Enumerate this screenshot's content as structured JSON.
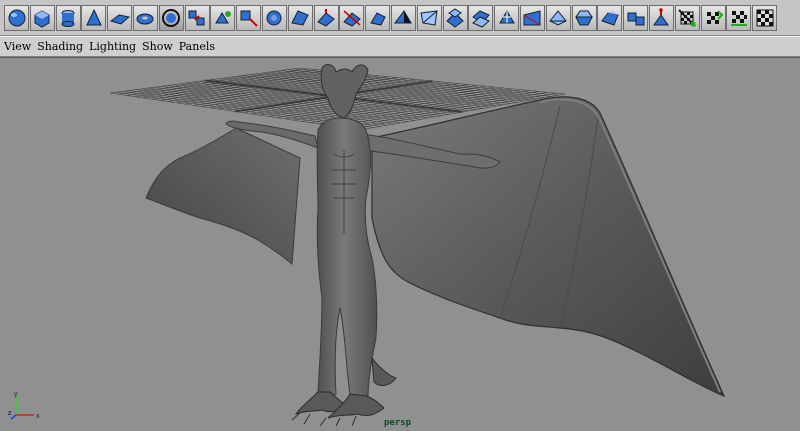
{
  "menubar": {
    "items": [
      "View",
      "Shading",
      "Lighting",
      "Show",
      "Panels"
    ]
  },
  "shelf": {
    "tools": [
      "poly-sphere-icon",
      "poly-cube-icon",
      "poly-cylinder-icon",
      "poly-cone-icon",
      "poly-plane-icon",
      "poly-torus-icon",
      "poly-pipe-icon",
      "combine-icon",
      "separate-icon",
      "extract-icon",
      "smooth-icon",
      "poly-prism-icon",
      "extrude-face-icon",
      "extrude-edge-icon",
      "bevel-icon",
      "append-polygon-icon",
      "split-polygon-icon",
      "merge-vertices-icon",
      "collapse-icon",
      "subdivide-icon",
      "cut-faces-icon",
      "duplicate-face-icon",
      "wedge-face-icon",
      "create-polygon-icon",
      "planar-mapping-icon",
      "cylindrical-mapping-icon",
      "spherical-mapping-icon",
      "auto-mapping-icon",
      "uv-layout-icon",
      "texture-checker-icon"
    ]
  },
  "viewport": {
    "camera": "persp",
    "axis": {
      "x": "x",
      "y": "y",
      "z": "z"
    }
  },
  "colors": {
    "viewport_bg": "#909090",
    "model": "#5f5f5f",
    "grid": "#3a3a3a",
    "tool_blue": "#2f6fd0"
  }
}
